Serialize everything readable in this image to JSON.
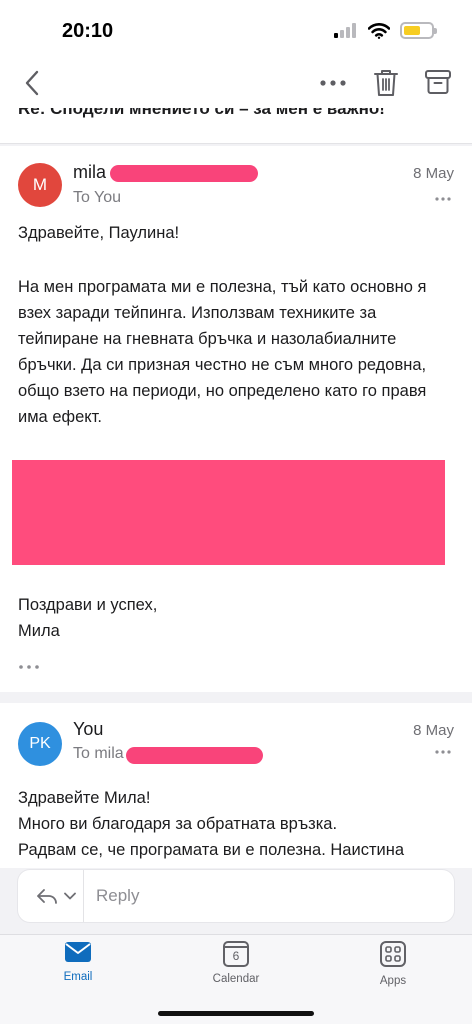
{
  "status_bar": {
    "time": "20:10",
    "battery_level": 0.6
  },
  "nav": {
    "icons": [
      "chevron-left-icon",
      "more-horizontal-icon",
      "trash-icon",
      "archive-icon"
    ]
  },
  "thread": {
    "subject_partial": "Re: Сподели мнението си – за мен е важно!"
  },
  "messages": [
    {
      "avatar_initials": "M",
      "avatar_color": "#e1473d",
      "sender": "mila",
      "to": "To You",
      "date": "8 May",
      "body": [
        "Здравейте, Паулина!",
        "На мен програмата ми е полезна, тъй като основно я взех заради тейпинга. Използвам техниките за тейпиране на гневната бръчка и назолабиалните бръчки.  Да си призная честно не съм много редовна, общо взето на периоди, но определено като го правя има ефект.",
        "Поздрави и успех,",
        "Мила"
      ],
      "redaction_color": "#ff4c7d"
    },
    {
      "avatar_initials": "PK",
      "avatar_color": "#2f90df",
      "sender": "You",
      "to": "To mila",
      "date": "8 May",
      "body": [
        "Здравейте Мила!",
        "Много ви благодаря за обратната връзка.",
        "Радвам се, че програмата ви е полезна. Наистина"
      ]
    }
  ],
  "reply": {
    "placeholder": "Reply"
  },
  "tabs": [
    {
      "label": "Email",
      "icon": "mail-icon",
      "active": true
    },
    {
      "label": "Calendar",
      "icon": "calendar-icon",
      "day": "6",
      "active": false
    },
    {
      "label": "Apps",
      "icon": "apps-grid-icon",
      "active": false
    }
  ],
  "colors": {
    "accent": "#0f6cbd",
    "inactive": "#616166",
    "redaction": "#f9447a"
  }
}
